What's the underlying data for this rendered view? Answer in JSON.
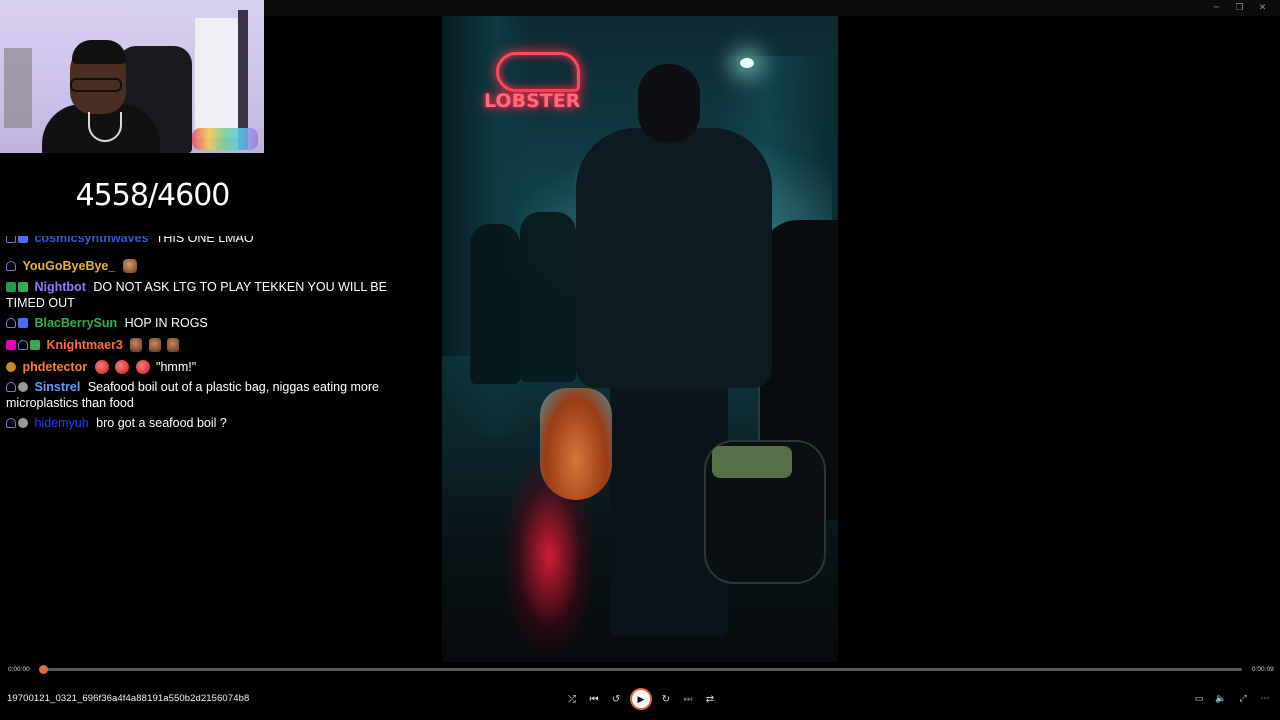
{
  "window": {
    "controls": [
      {
        "name": "minimize-icon",
        "glyph": "─"
      },
      {
        "name": "restore-icon",
        "glyph": "❐"
      },
      {
        "name": "close-icon",
        "glyph": "✕"
      }
    ]
  },
  "overlay": {
    "counter": "4558/4600"
  },
  "chat": {
    "messages": [
      {
        "user": "cosmicsynthwaves",
        "user_color": "#3a56c8",
        "text": "THIS ONE LMAO"
      },
      {
        "user": "YouGoByeBye_",
        "user_color": "#e0b32e",
        "text": ""
      },
      {
        "user": "Nightbot",
        "user_color": "#8a78ff",
        "text": "DO NOT ASK LTG TO PLAY TEKKEN YOU WILL BE TIMED OUT"
      },
      {
        "user": "BlacBerrySun",
        "user_color": "#2eb34a",
        "text": "HOP IN ROGS"
      },
      {
        "user": "Knightmaer3",
        "user_color": "#ff6a3c",
        "text": ""
      },
      {
        "user": "phdetector",
        "user_color": "#ff7a3a",
        "text": "\"hmm!\""
      },
      {
        "user": "Sinstrel",
        "user_color": "#5b9dff",
        "text": "Seafood boil out of a plastic bag, niggas eating more microplastics than food"
      },
      {
        "user": "hidemyuh",
        "user_color": "#1f3bff",
        "text": "bro got a seafood boil ?"
      }
    ]
  },
  "video": {
    "neon_sign": "LOBSTER"
  },
  "player": {
    "current_time": "0:00:00",
    "total_time": "0:00:09",
    "progress": 0.0,
    "filename": "19700121_0321_696f36a4f4a88191a550b2d2156074b8",
    "accent_color": "#e46a3c",
    "controls": {
      "shuffle_icon": "⤮",
      "previous_icon": "⏮",
      "rewind_icon": "↺",
      "play_icon": "▶",
      "forward_icon": "↻",
      "next_icon": "⏭",
      "repeat_icon": "⇄"
    },
    "right_controls": {
      "miniplayer_icon": "▭",
      "volume_icon": "🔈",
      "fullscreen_icon": "⤢",
      "more_icon": "⋯"
    }
  }
}
